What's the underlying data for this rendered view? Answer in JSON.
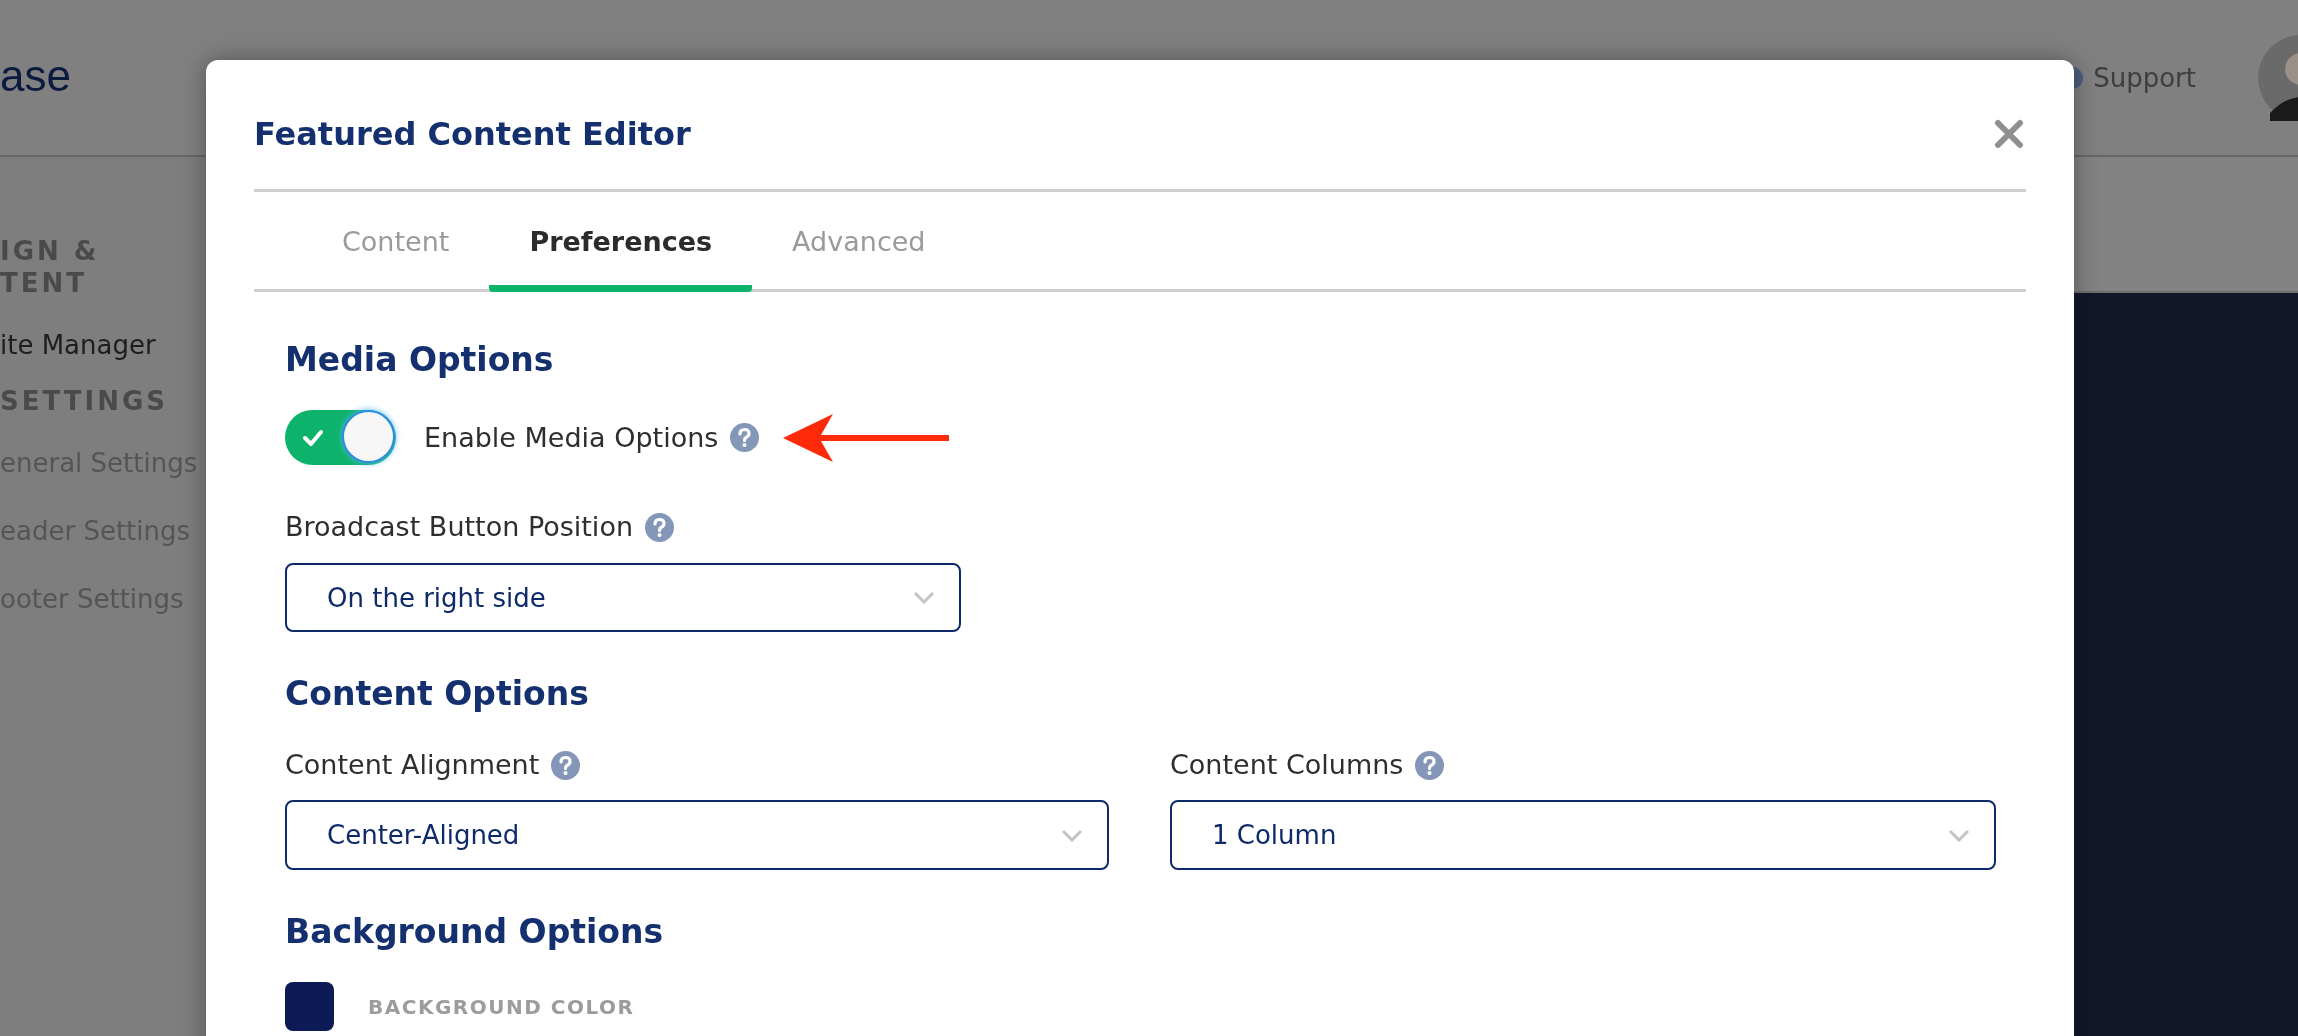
{
  "header": {
    "logo_text": "ase",
    "support_link": "Support"
  },
  "sidebar": {
    "sections": [
      {
        "heading_lines": [
          "IGN &",
          "TENT"
        ],
        "items": [
          {
            "label": "ite Manager",
            "selected": true
          }
        ]
      },
      {
        "heading_lines": [
          "SETTINGS"
        ],
        "items": [
          {
            "label": "eneral Settings",
            "selected": false
          },
          {
            "label": "eader Settings",
            "selected": false
          },
          {
            "label": "ooter Settings",
            "selected": false
          }
        ]
      }
    ]
  },
  "modal": {
    "title": "Featured Content Editor",
    "tabs": [
      {
        "label": "Content",
        "selected": false
      },
      {
        "label": "Preferences",
        "selected": true
      },
      {
        "label": "Advanced",
        "selected": false
      }
    ],
    "sections": [
      {
        "title": "Media Options",
        "rows": [
          [
            {
              "kind": "toggle",
              "label": "Enable Media Options",
              "on": true
            }
          ],
          [
            {
              "kind": "select",
              "label": "Broadcast Button Position",
              "value": "On the right side"
            }
          ]
        ]
      },
      {
        "title": "Content Options",
        "rows": [
          [
            {
              "kind": "select",
              "label": "Content Alignment",
              "value": "Center-Aligned"
            },
            {
              "kind": "select",
              "label": "Content Columns",
              "value": "1 Column"
            }
          ]
        ]
      },
      {
        "title": "Background Options",
        "rows": [
          [
            {
              "kind": "color",
              "label": "BACKGROUND COLOR",
              "color": "#0c1a55"
            }
          ]
        ]
      }
    ]
  }
}
